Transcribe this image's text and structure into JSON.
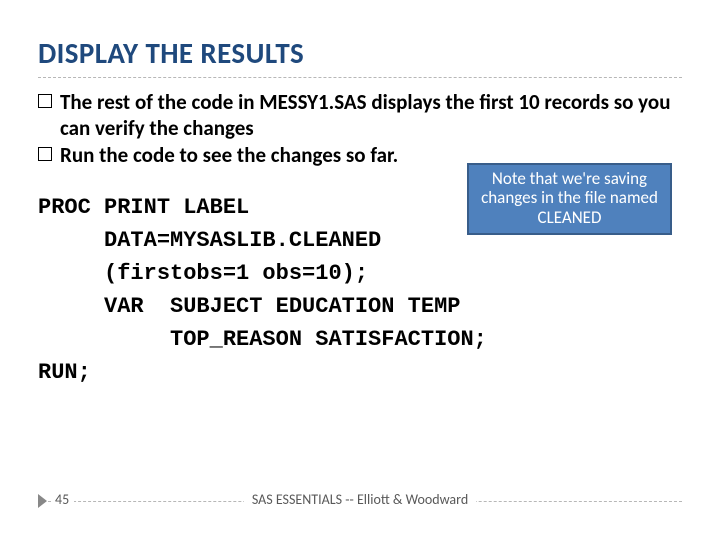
{
  "title": "DISPLAY THE RESULTS",
  "bullets": [
    "The rest of the code in MESSY1.SAS displays the first 10 records so you can verify the changes",
    "Run the code to see the changes so far."
  ],
  "callout": "Note that we're saving changes in the file named CLEANED",
  "code": {
    "l1": "PROC PRINT LABEL",
    "l2": "     DATA=MYSASLIB.CLEANED",
    "l3": "     (firstobs=1 obs=10);",
    "l4": "     VAR  SUBJECT EDUCATION TEMP",
    "l5": "          TOP_REASON SATISFACTION;",
    "l6": "RUN;"
  },
  "footer": {
    "page": "45",
    "text": "SAS ESSENTIALS -- Elliott & Woodward"
  }
}
